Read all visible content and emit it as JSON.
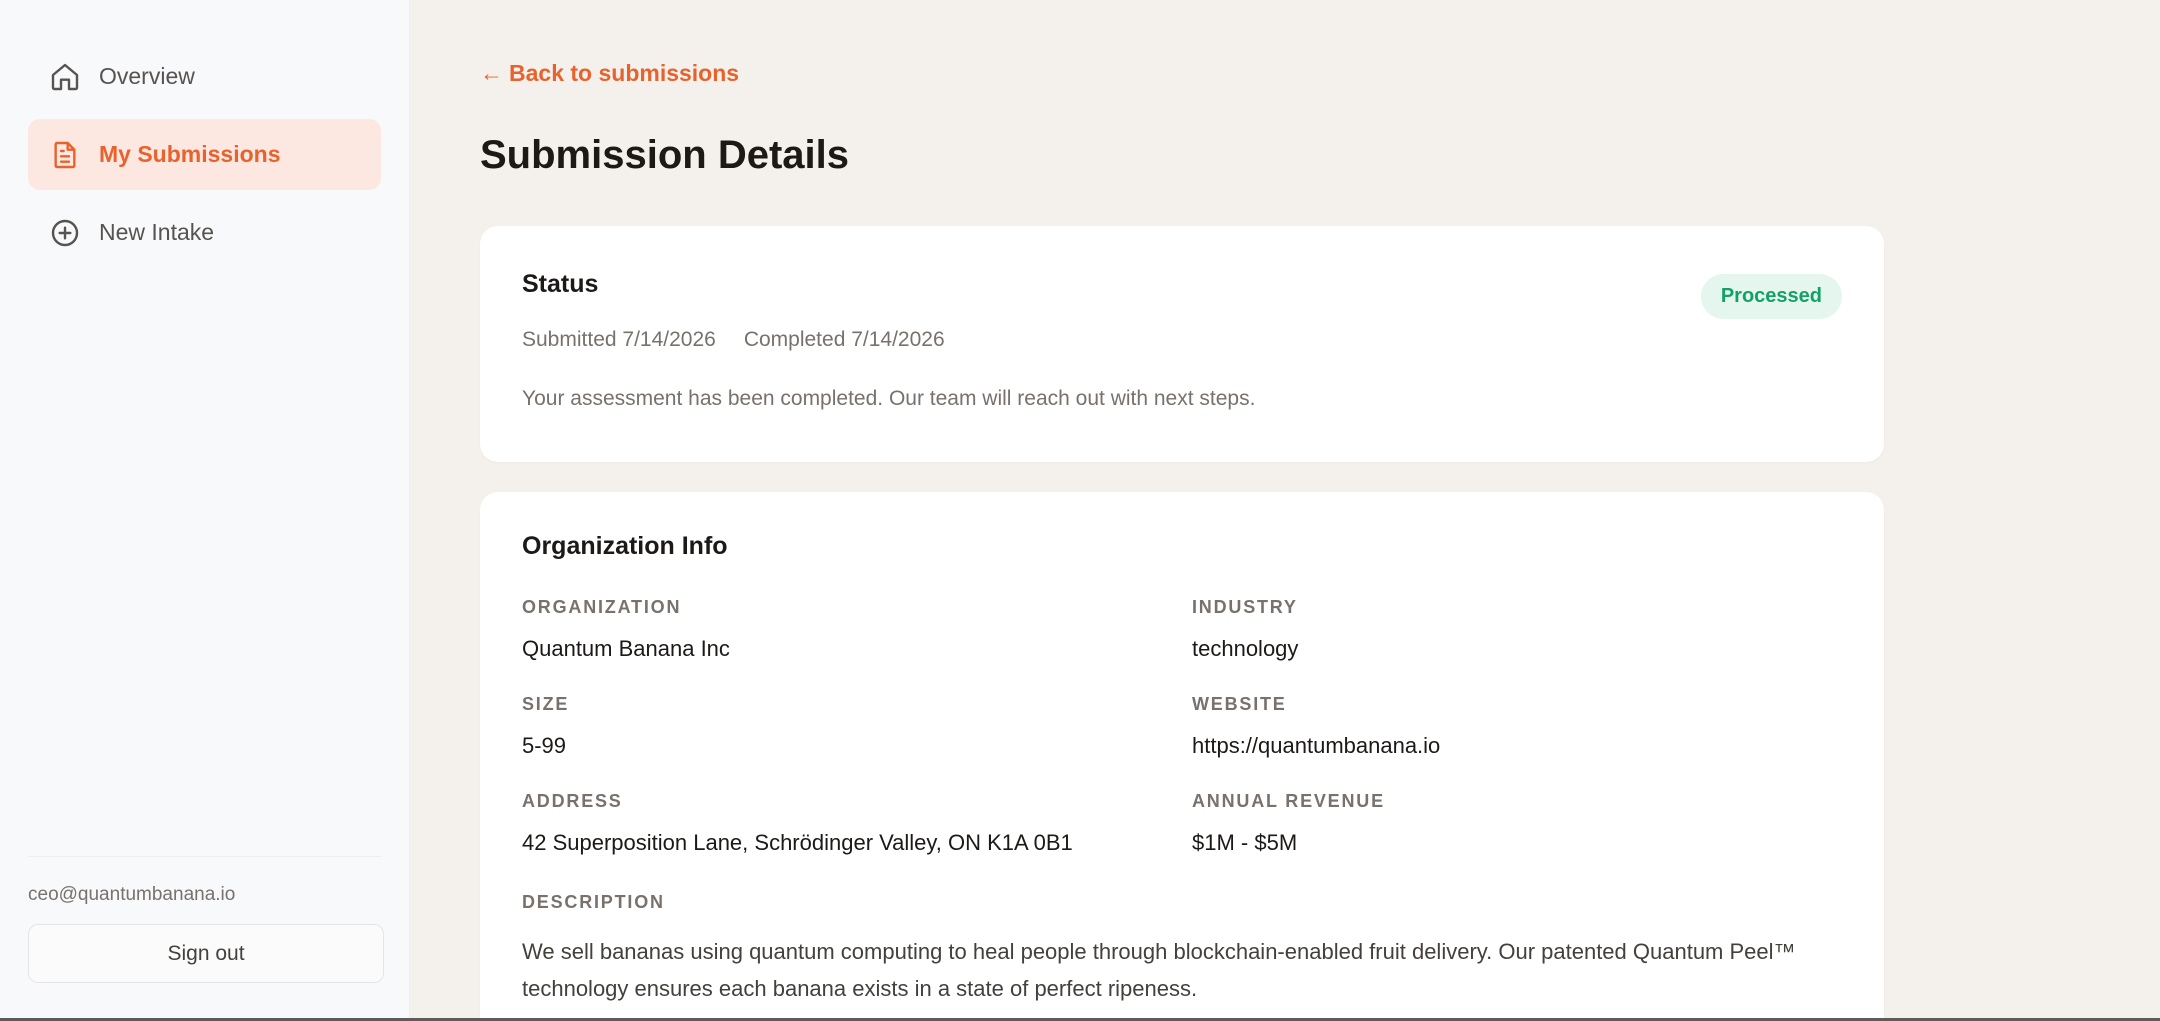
{
  "sidebar": {
    "items": [
      {
        "label": "Overview",
        "icon": "home-icon",
        "active": false
      },
      {
        "label": "My Submissions",
        "icon": "document-icon",
        "active": true
      },
      {
        "label": "New Intake",
        "icon": "plus-circle-icon",
        "active": false
      }
    ],
    "user_email": "ceo@quantumbanana.io",
    "signout_label": "Sign out"
  },
  "main": {
    "back_label": "Back to submissions",
    "page_title": "Submission Details",
    "status": {
      "title": "Status",
      "badge": "Processed",
      "submitted": "Submitted 7/14/2026",
      "completed": "Completed 7/14/2026",
      "message": "Your assessment has been completed. Our team will reach out with next steps."
    },
    "org": {
      "title": "Organization Info",
      "fields": [
        {
          "label": "ORGANIZATION",
          "value": "Quantum Banana Inc"
        },
        {
          "label": "INDUSTRY",
          "value": "technology"
        },
        {
          "label": "SIZE",
          "value": "5-99"
        },
        {
          "label": "WEBSITE",
          "value": "https://quantumbanana.io"
        },
        {
          "label": "ADDRESS",
          "value": "42 Superposition Lane, Schrödinger Valley, ON K1A 0B1"
        },
        {
          "label": "ANNUAL REVENUE",
          "value": "$1M - $5M"
        }
      ],
      "description_label": "DESCRIPTION",
      "description": "We sell bananas using quantum computing to heal people through blockchain-enabled fruit delivery. Our patented Quantum Peel™ technology ensures each banana exists in a state of perfect ripeness."
    }
  },
  "colors": {
    "accent": "#e8622e",
    "accent_bg": "#fce8e1",
    "success": "#16a069",
    "success_bg": "#e4f6ee",
    "page_bg": "#f4f1ec"
  }
}
